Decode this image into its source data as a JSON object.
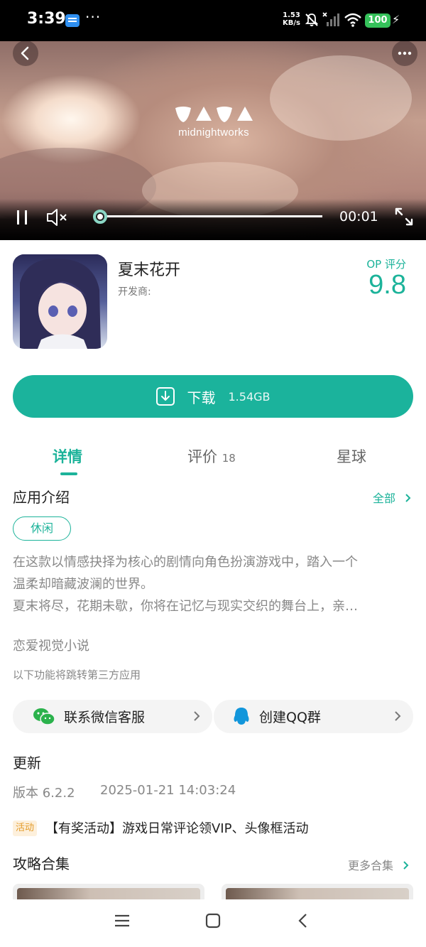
{
  "status_bar": {
    "time": "3:39",
    "more": "···",
    "net_speed_value": "1.53",
    "net_speed_unit": "KB/s",
    "battery": "100"
  },
  "video": {
    "logo_text": "midnightworks",
    "time": "00:01",
    "progress_fraction": 0.01,
    "icons": [
      "back-icon",
      "more-icon",
      "pause-icon",
      "mute-icon",
      "fullscreen-icon"
    ]
  },
  "app": {
    "title": "夏末花开",
    "developer_label": "开发商:",
    "score_label": "OP 评分",
    "score": "9.8",
    "download_label": "下载",
    "download_size": "1.54GB"
  },
  "tabs": [
    {
      "label": "详情",
      "count": "",
      "active": true
    },
    {
      "label": "评价",
      "count": "18",
      "active": false
    },
    {
      "label": "星球",
      "count": "",
      "active": false
    }
  ],
  "intro": {
    "title": "应用介绍",
    "link": "全部",
    "tag": "休闲",
    "desc_lines": [
      "在这款以情感抉择为核心的剧情向角色扮演游戏中，踏入一个",
      "温柔却暗藏波澜的世界。",
      "夏末将尽，花期未歇，你将在记忆与现实交织的舞台上，亲…"
    ],
    "category": "恋爱视觉小说",
    "third_party_note": "以下功能将跳转第三方应用"
  },
  "contacts": [
    {
      "label": "联系微信客服",
      "icon": "wechat-icon"
    },
    {
      "label": "创建QQ群",
      "icon": "qq-icon"
    }
  ],
  "update": {
    "title": "更新",
    "version": "版本 6.2.2",
    "time": "2025-01-21 14:03:24",
    "badge": "活动",
    "event": "【有奖活动】游戏日常评论领VIP、头像框活动"
  },
  "guides": {
    "title": "攻略合集",
    "link": "更多合集"
  },
  "colors": {
    "accent": "#1cb39a",
    "badge_bg": "#fdf0dc",
    "badge_fg": "#e39a28"
  }
}
